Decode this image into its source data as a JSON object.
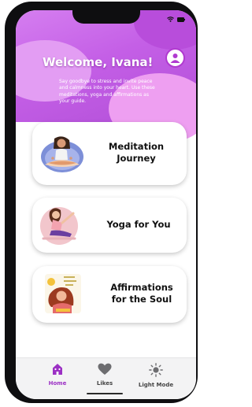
{
  "header": {
    "greeting": "Welcome, Ivana!",
    "intro": "Say goodbye to stress and invite peace and calmness into your heart. Use these meditations, yoga and affirmations as your guide."
  },
  "cards": [
    {
      "label_line1": "Meditation",
      "label_line2": "Journey",
      "icon": "meditation-illustration"
    },
    {
      "label_line1": "Yoga for You",
      "label_line2": "",
      "icon": "yoga-illustration"
    },
    {
      "label_line1": "Affirmations",
      "label_line2": "for the Soul",
      "icon": "affirmations-illustration"
    }
  ],
  "nav": {
    "items": [
      {
        "label": "Home",
        "icon": "home-icon",
        "active": true
      },
      {
        "label": "Likes",
        "icon": "heart-icon",
        "active": false
      },
      {
        "label": "Light Mode",
        "icon": "sun-icon",
        "active": false
      }
    ]
  },
  "colors": {
    "accent": "#b03ad0",
    "header": "#c45fe6",
    "nav_active": "#9b2fc4",
    "nav_inactive": "#555555"
  }
}
